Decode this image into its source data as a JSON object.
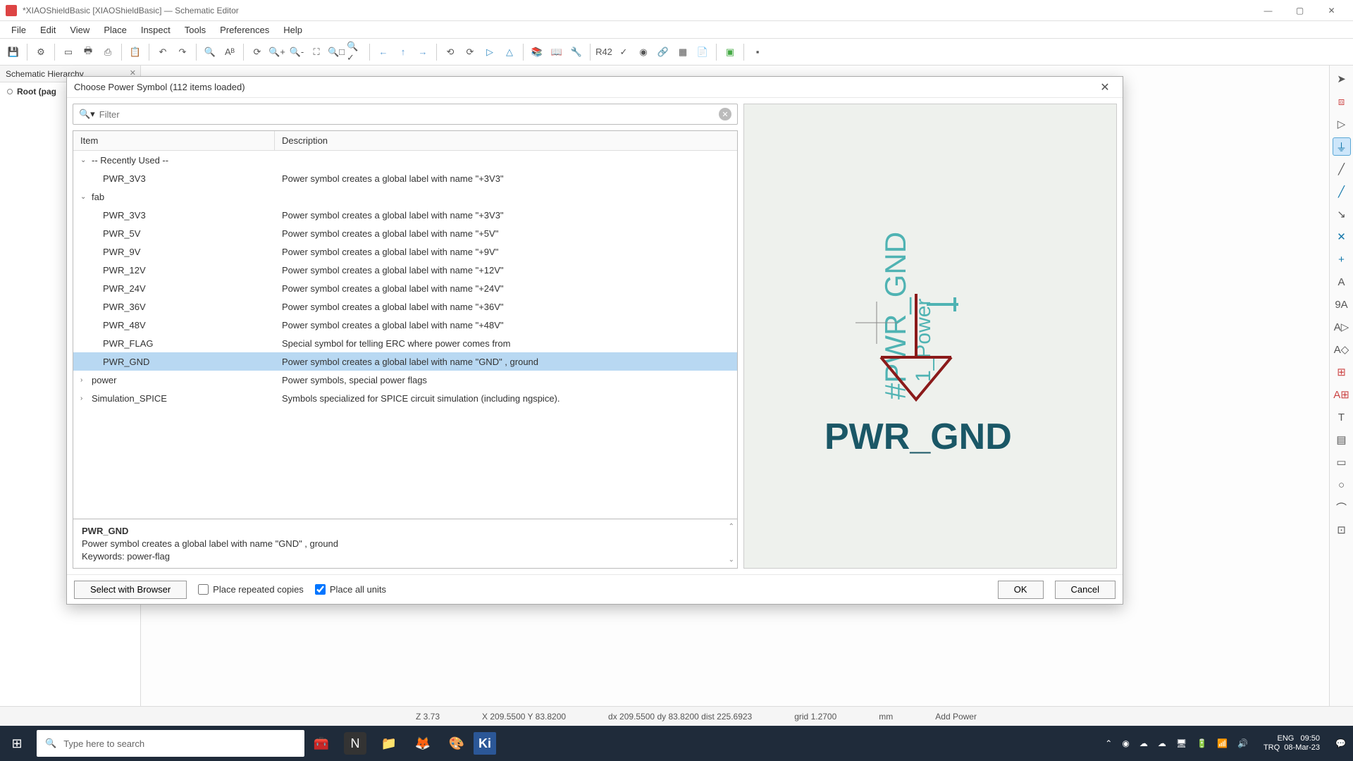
{
  "window": {
    "title": "*XIAOShieldBasic [XIAOShieldBasic] — Schematic Editor"
  },
  "menu": [
    "File",
    "Edit",
    "View",
    "Place",
    "Inspect",
    "Tools",
    "Preferences",
    "Help"
  ],
  "hierarchy": {
    "header": "Schematic Hierarchy",
    "root": "Root (pag"
  },
  "dialog": {
    "title": "Choose Power Symbol (112 items loaded)",
    "filter_placeholder": "Filter",
    "headers": {
      "item": "Item",
      "desc": "Description"
    },
    "rows": [
      {
        "type": "group",
        "label": "-- Recently Used --",
        "expanded": true
      },
      {
        "type": "leaf",
        "indent": 2,
        "label": "PWR_3V3",
        "desc": "Power symbol creates a global label with name \"+3V3\""
      },
      {
        "type": "group",
        "label": "fab",
        "expanded": true
      },
      {
        "type": "leaf",
        "indent": 2,
        "label": "PWR_3V3",
        "desc": "Power symbol creates a global label with name \"+3V3\""
      },
      {
        "type": "leaf",
        "indent": 2,
        "label": "PWR_5V",
        "desc": "Power symbol creates a global label with name \"+5V\""
      },
      {
        "type": "leaf",
        "indent": 2,
        "label": "PWR_9V",
        "desc": "Power symbol creates a global label with name \"+9V\""
      },
      {
        "type": "leaf",
        "indent": 2,
        "label": "PWR_12V",
        "desc": "Power symbol creates a global label with name \"+12V\""
      },
      {
        "type": "leaf",
        "indent": 2,
        "label": "PWR_24V",
        "desc": "Power symbol creates a global label with name \"+24V\""
      },
      {
        "type": "leaf",
        "indent": 2,
        "label": "PWR_36V",
        "desc": "Power symbol creates a global label with name \"+36V\""
      },
      {
        "type": "leaf",
        "indent": 2,
        "label": "PWR_48V",
        "desc": "Power symbol creates a global label with name \"+48V\""
      },
      {
        "type": "leaf",
        "indent": 2,
        "label": "PWR_FLAG",
        "desc": "Special symbol for telling ERC where power comes from"
      },
      {
        "type": "leaf",
        "indent": 2,
        "label": "PWR_GND",
        "desc": "Power symbol creates a global label with name \"GND\" , ground",
        "selected": true
      },
      {
        "type": "group",
        "label": "power",
        "expanded": false,
        "desc": "Power symbols, special power flags"
      },
      {
        "type": "group",
        "label": "Simulation_SPICE",
        "expanded": false,
        "desc": "Symbols specialized for SPICE circuit simulation (including ngspice)."
      }
    ],
    "detail": {
      "name": "PWR_GND",
      "desc": "Power symbol creates a global label with name \"GND\" , ground",
      "keywords": "Keywords: power-flag"
    },
    "footer": {
      "browser": "Select with Browser",
      "repeated": "Place repeated copies",
      "allunits": "Place all units",
      "ok": "OK",
      "cancel": "Cancel"
    },
    "preview": {
      "ref": "#PWR_GND",
      "sub": "1_Power",
      "value": "PWR_GND"
    }
  },
  "status": {
    "z": "Z 3.73",
    "xy": "X 209.5500  Y 83.8200",
    "dxy": "dx 209.5500  dy 83.8200  dist 225.6923",
    "grid": "grid 1.2700",
    "unit": "mm",
    "tool": "Add Power"
  },
  "taskbar": {
    "search": "Type here to search",
    "lang": "ENG",
    "time": "09:50",
    "loc": "TRQ",
    "date": "08-Mar-23"
  }
}
